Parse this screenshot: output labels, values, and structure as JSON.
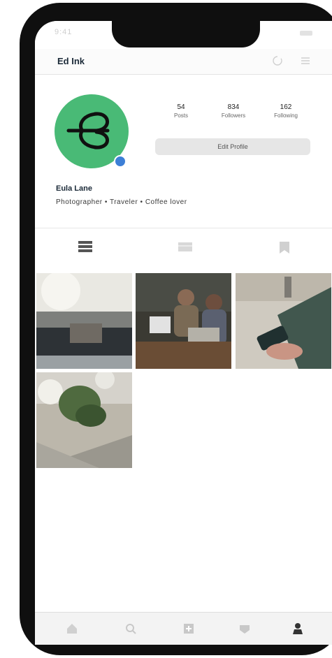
{
  "status_bar": {
    "time": "9:41"
  },
  "nav": {
    "title": "Ed Ink"
  },
  "profile": {
    "name": "Eula Lane",
    "bio": "Photographer • Traveler • Coffee lover",
    "stats": [
      {
        "count": "54",
        "label": "Posts"
      },
      {
        "count": "834",
        "label": "Followers"
      },
      {
        "count": "162",
        "label": "Following"
      }
    ],
    "edit_label": "Edit Profile"
  },
  "tabs": [
    "grid-tab",
    "list-tab",
    "tagged-tab"
  ],
  "photos": [
    "car-dashboard-photo",
    "people-laptops-photo",
    "phone-hand-photo",
    "plant-ledge-photo"
  ],
  "tabbar": [
    "home",
    "search",
    "add",
    "activity",
    "profile"
  ],
  "colors": {
    "brand_green": "#49ba76",
    "verify_blue": "#3d7fd6",
    "title": "#1b2a38"
  }
}
